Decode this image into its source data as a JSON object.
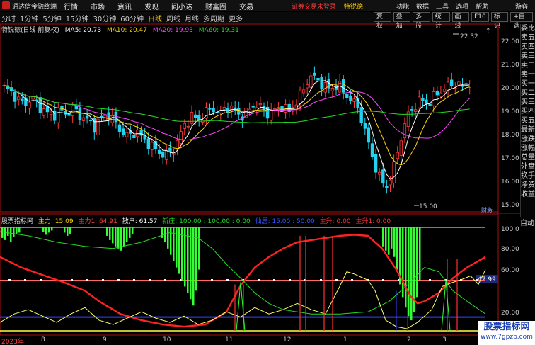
{
  "titlebar": {
    "app_title": "通达信金融终端",
    "menu": [
      "行情",
      "市场",
      "资讯",
      "发现",
      "问小达",
      "财富圈",
      "交易"
    ],
    "login_warning": "证券交易未登录",
    "stock_name": "特锐德",
    "right_links": [
      "功能",
      "数据",
      "工具",
      "选项",
      "帮助"
    ],
    "guest": "游客"
  },
  "toolbar": {
    "periods": [
      "分时",
      "1分钟",
      "5分钟",
      "15分钟",
      "30分钟",
      "60分钟",
      "日线",
      "周线",
      "月线",
      "多周期",
      "更多"
    ],
    "active_period": "日线",
    "tools": [
      "复权",
      "叠加",
      "多股",
      "统计",
      "画线",
      "F10",
      "标记",
      "+自选"
    ]
  },
  "main_legend": {
    "title": "特锐德(日线 前复权)",
    "ma5": "MA5: 20.73",
    "ma10": "MA10: 20.47",
    "ma20": "MA20: 19.93",
    "ma60": "MA60: 19.31",
    "colors": {
      "ma5": "#ffffff",
      "ma10": "#ffd700",
      "ma20": "#ff44ff",
      "ma60": "#22dd22"
    }
  },
  "main_axis": {
    "ticks": [
      "22.00",
      "21.00",
      "20.00",
      "19.00",
      "18.00",
      "17.00",
      "16.00",
      "15.00"
    ],
    "high_label": "22.32",
    "low_label": "15.00",
    "finance_label": "财务"
  },
  "sub_legend": {
    "name": "股票指标网",
    "zhuli": "主力: 15.09",
    "zhuli1": "主力1: 64.91",
    "sanhu": "散户: 61.57",
    "xinzhuang": "新庄: 100.00 : 100.00 : 0.00",
    "xianju": "仙居: 15.00 : 50.00",
    "zhusheng": "主升: 0.00",
    "zhusheng1": "主升1: 0.00"
  },
  "sub_axis": {
    "ticks": [
      "100.0",
      "80.00",
      "60.00",
      "40.00",
      "20.00"
    ],
    "current": "47.99"
  },
  "right_panel": [
    "委比",
    "卖五",
    "卖四",
    "卖三",
    "卖二",
    "卖一",
    "买一",
    "买二",
    "买三",
    "买四",
    "买五",
    "最新",
    "涨跌",
    "涨幅",
    "总量",
    "外盘",
    "换手",
    "净资",
    "收益"
  ],
  "auto_label": "自动",
  "dates": [
    "2023年",
    "8",
    "9",
    "10",
    "11",
    "12",
    "1",
    "2",
    "3"
  ],
  "watermark": {
    "title": "股票指标网",
    "url": "www.7gpzb.com"
  },
  "chart_data": {
    "type": "candlestick",
    "ylim": [
      14.8,
      22.6
    ],
    "ma5_approx": [
      20.4,
      20.1,
      19.9,
      19.7,
      19.4,
      19.2,
      19.0,
      19.1,
      19.0,
      18.8,
      18.4,
      18.2,
      18.0,
      17.9,
      17.6,
      17.4,
      17.3,
      17.8,
      18.5,
      18.8,
      19.0,
      19.1,
      19.2,
      19.3,
      19.4,
      19.3,
      19.2,
      19.4,
      20.2,
      20.9,
      20.6,
      20.4,
      20.2,
      19.6,
      18.3,
      16.6,
      16.2,
      16.8,
      18.5,
      19.6,
      19.7,
      20.2,
      20.5,
      20.7
    ],
    "sub_ylim": [
      0,
      100
    ]
  }
}
